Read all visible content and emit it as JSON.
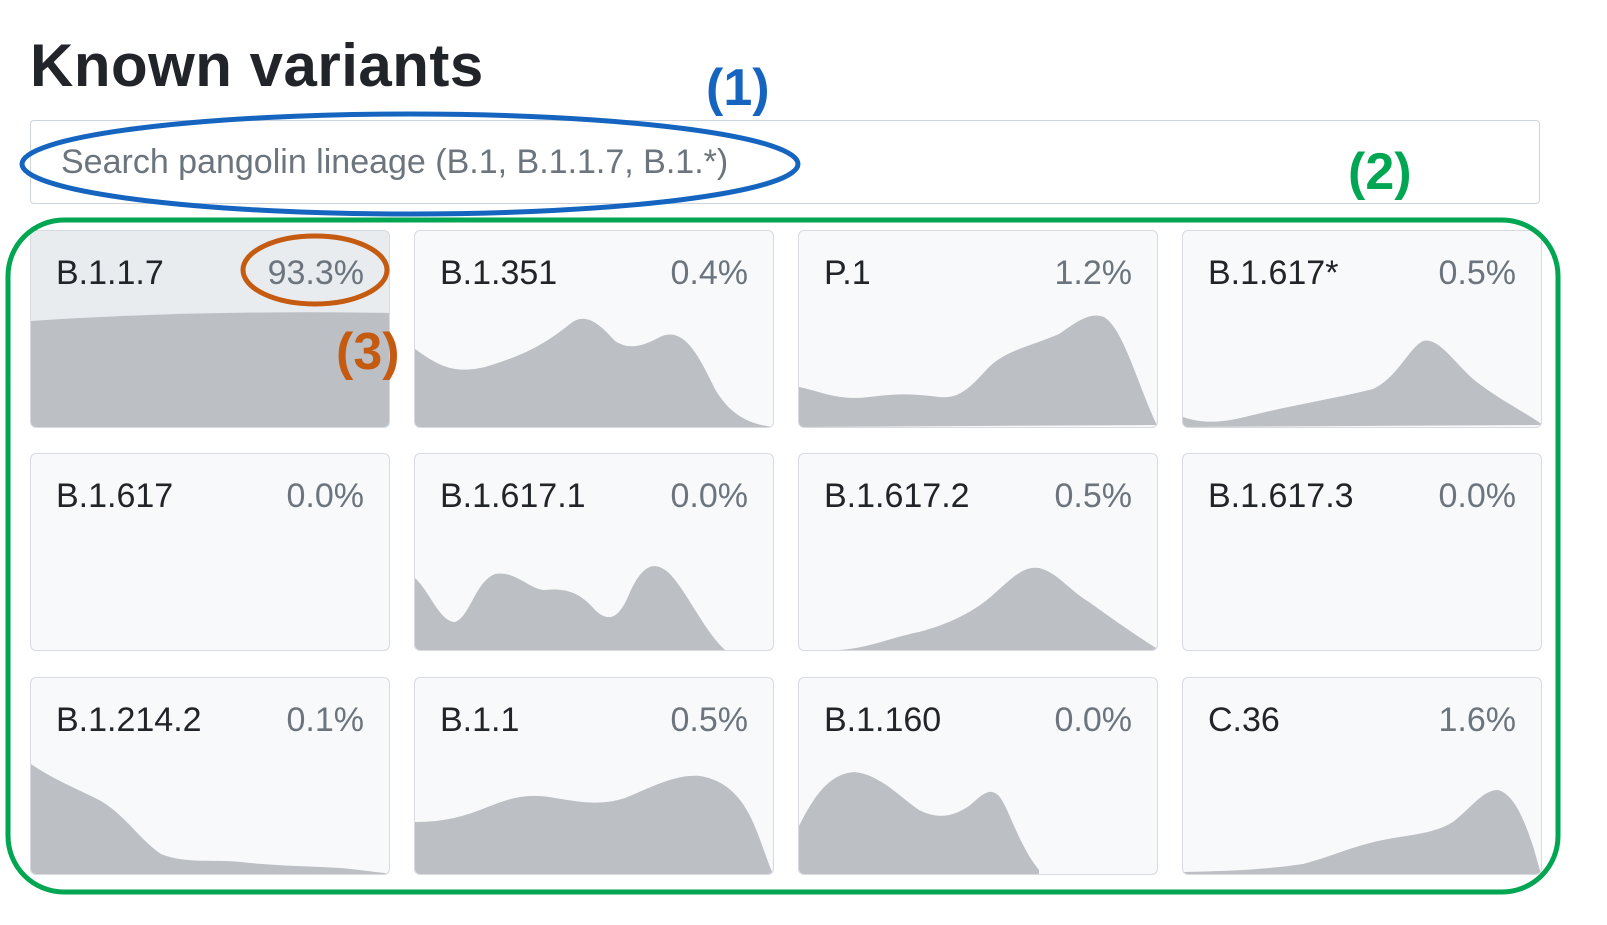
{
  "page": {
    "title": "Known variants"
  },
  "search": {
    "placeholder": "Search pangolin lineage (B.1, B.1.1.7, B.1.*)",
    "value": ""
  },
  "annotations": {
    "label_1": "(1)",
    "label_2": "(2)",
    "label_3": "(3)",
    "color_1": "#1565c0",
    "color_2": "#00a651",
    "color_3": "#c55a11"
  },
  "variants": [
    {
      "name": "B.1.1.7",
      "percent": "93.3%",
      "selected": true
    },
    {
      "name": "B.1.351",
      "percent": "0.4%",
      "selected": false
    },
    {
      "name": "P.1",
      "percent": "1.2%",
      "selected": false
    },
    {
      "name": "B.1.617*",
      "percent": "0.5%",
      "selected": false
    },
    {
      "name": "B.1.617",
      "percent": "0.0%",
      "selected": false
    },
    {
      "name": "B.1.617.1",
      "percent": "0.0%",
      "selected": false
    },
    {
      "name": "B.1.617.2",
      "percent": "0.5%",
      "selected": false
    },
    {
      "name": "B.1.617.3",
      "percent": "0.0%",
      "selected": false
    },
    {
      "name": "B.1.214.2",
      "percent": "0.1%",
      "selected": false
    },
    {
      "name": "B.1.1",
      "percent": "0.5%",
      "selected": false
    },
    {
      "name": "B.1.160",
      "percent": "0.0%",
      "selected": false
    },
    {
      "name": "C.36",
      "percent": "1.6%",
      "selected": false
    }
  ],
  "colors": {
    "card_bg": "#f8f9fa",
    "card_selected_bg": "#e9ecef",
    "sparkline_fill": "#bcc0c4",
    "text": "#212529",
    "muted_text": "#6c757d"
  }
}
